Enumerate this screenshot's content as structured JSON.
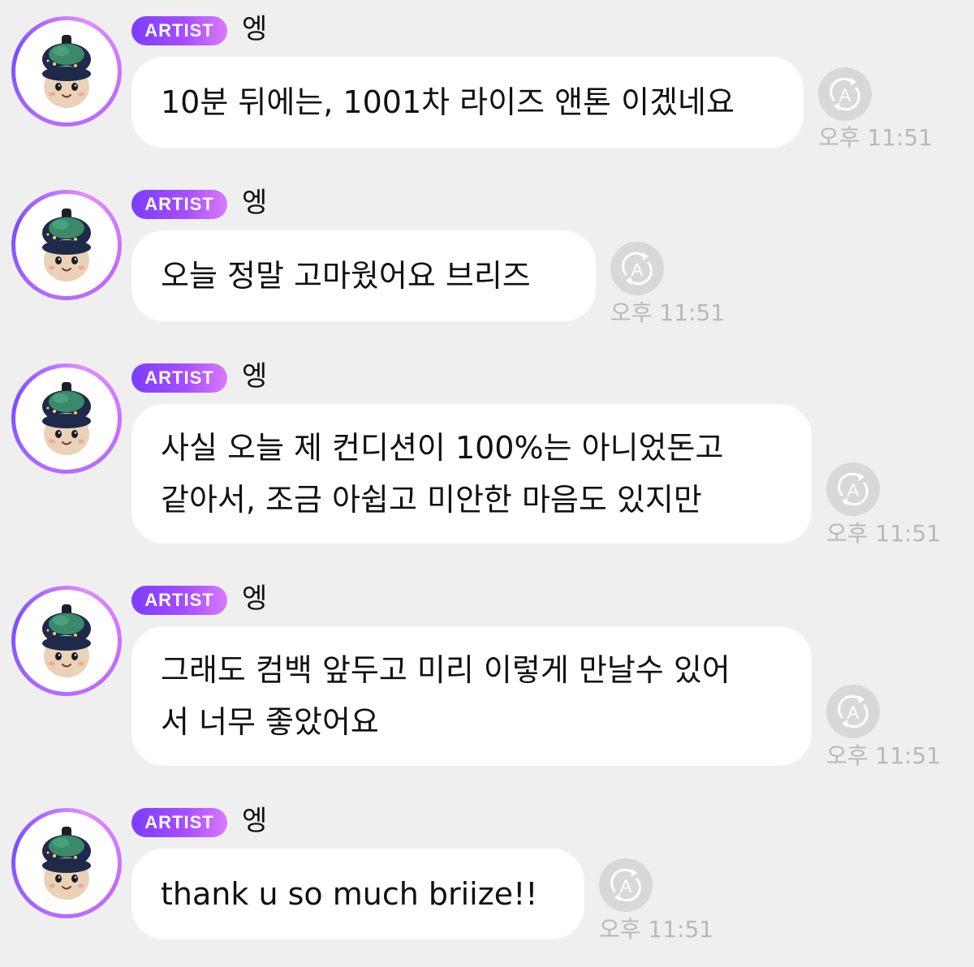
{
  "colors": {
    "background": "#efefef",
    "bubble": "#ffffff",
    "badge_gradient_start": "#7b3dff",
    "badge_gradient_end": "#d879ff",
    "timestamp": "#b8b8b8",
    "translate_icon_bg": "#d8d8d8"
  },
  "messages": [
    {
      "badge": "ARTIST",
      "sender": "엥",
      "lines": [
        "10분 뒤에는, 1001차 라이즈 앤톤 이겠네요"
      ],
      "translate_icon": "translate-icon",
      "time": "오후 11:51"
    },
    {
      "badge": "ARTIST",
      "sender": "엥",
      "lines": [
        "오늘 정말 고마웠어요 브리즈"
      ],
      "translate_icon": "translate-icon",
      "time": "오후 11:51"
    },
    {
      "badge": "ARTIST",
      "sender": "엥",
      "lines": [
        "사실 오늘 제 컨디션이 100%는 아니었돈고",
        "같아서, 조금 아쉽고 미안한 마음도 있지만"
      ],
      "translate_icon": "translate-icon",
      "time": "오후 11:51"
    },
    {
      "badge": "ARTIST",
      "sender": "엥",
      "lines": [
        "그래도 컴백 앞두고 미리 이렇게 만날수 있어",
        "서 너무 좋았어요"
      ],
      "translate_icon": "translate-icon",
      "time": "오후 11:51"
    },
    {
      "badge": "ARTIST",
      "sender": "엥",
      "lines": [
        "thank u so much briize!!"
      ],
      "translate_icon": "translate-icon",
      "time": "오후 11:51"
    }
  ]
}
